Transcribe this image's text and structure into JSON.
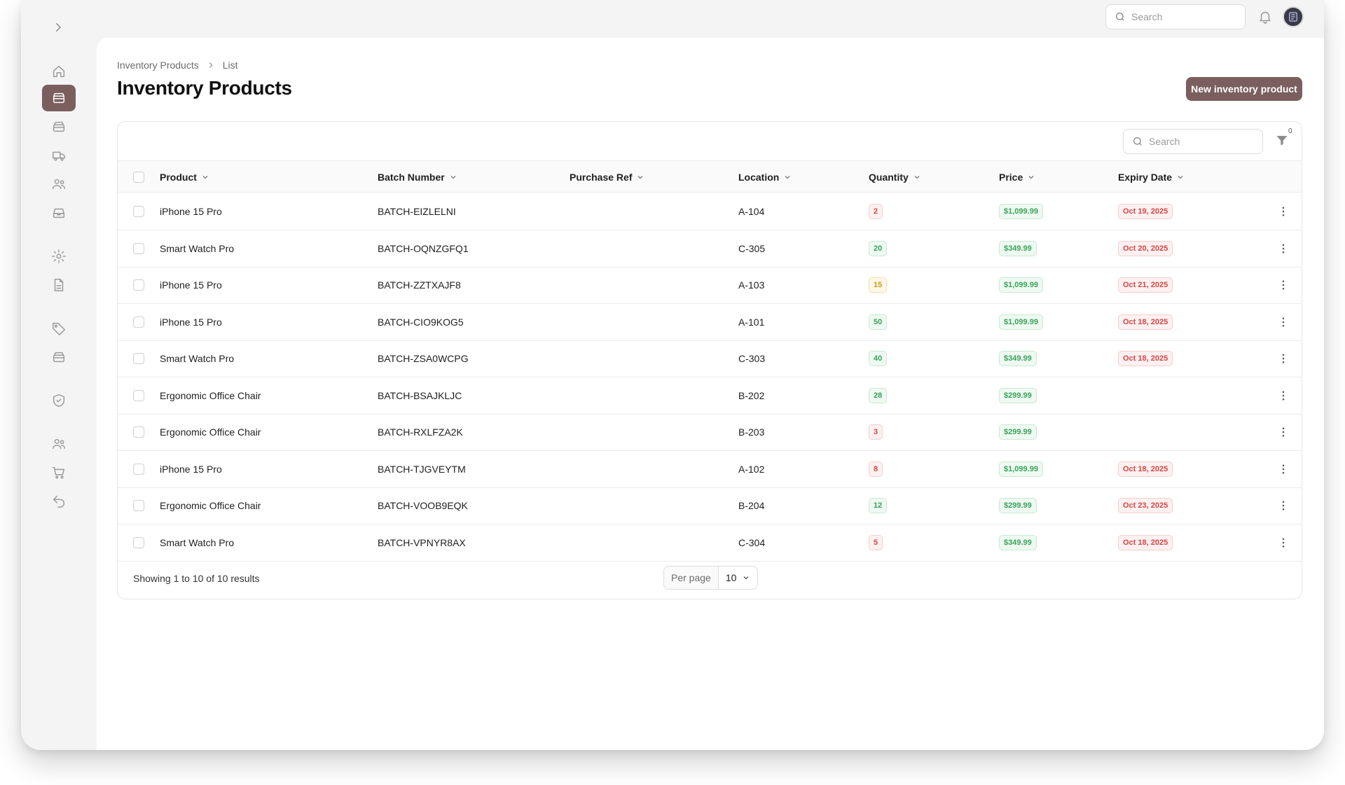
{
  "topbar": {
    "search_placeholder": "Search"
  },
  "sidebar": {
    "items": [
      {
        "icon": "home-icon",
        "active": false
      },
      {
        "icon": "inventory-box-icon",
        "active": true
      },
      {
        "icon": "archive-box-icon",
        "active": false
      },
      {
        "icon": "truck-icon",
        "active": false
      },
      {
        "icon": "users-icon",
        "active": false
      },
      {
        "icon": "inbox-icon",
        "active": false
      },
      {
        "icon": "gear-icon",
        "active": false
      },
      {
        "icon": "document-icon",
        "active": false
      },
      {
        "icon": "tag-icon",
        "active": false
      },
      {
        "icon": "archive-box-icon",
        "active": false
      },
      {
        "icon": "shield-check-icon",
        "active": false
      },
      {
        "icon": "users-icon",
        "active": false
      },
      {
        "icon": "cart-icon",
        "active": false
      },
      {
        "icon": "return-arrow-icon",
        "active": false
      }
    ]
  },
  "breadcrumb": {
    "parent": "Inventory Products",
    "current": "List"
  },
  "page": {
    "title": "Inventory Products",
    "new_button": "New inventory product"
  },
  "table": {
    "search_placeholder": "Search",
    "filter_count": "0",
    "columns": [
      "Product",
      "Batch Number",
      "Purchase Ref",
      "Location",
      "Quantity",
      "Price",
      "Expiry Date"
    ],
    "rows": [
      {
        "product": "iPhone 15 Pro",
        "batch": "BATCH-EIZLELNI",
        "purchase_ref": "",
        "location": "A-104",
        "quantity": "2",
        "qty_status": "red",
        "price": "$1,099.99",
        "expiry": "Oct 19, 2025"
      },
      {
        "product": "Smart Watch Pro",
        "batch": "BATCH-OQNZGFQ1",
        "purchase_ref": "",
        "location": "C-305",
        "quantity": "20",
        "qty_status": "green",
        "price": "$349.99",
        "expiry": "Oct 20, 2025"
      },
      {
        "product": "iPhone 15 Pro",
        "batch": "BATCH-ZZTXAJF8",
        "purchase_ref": "",
        "location": "A-103",
        "quantity": "15",
        "qty_status": "yellow",
        "price": "$1,099.99",
        "expiry": "Oct 21, 2025"
      },
      {
        "product": "iPhone 15 Pro",
        "batch": "BATCH-CIO9KOG5",
        "purchase_ref": "",
        "location": "A-101",
        "quantity": "50",
        "qty_status": "green",
        "price": "$1,099.99",
        "expiry": "Oct 18, 2025"
      },
      {
        "product": "Smart Watch Pro",
        "batch": "BATCH-ZSA0WCPG",
        "purchase_ref": "",
        "location": "C-303",
        "quantity": "40",
        "qty_status": "green",
        "price": "$349.99",
        "expiry": "Oct 18, 2025"
      },
      {
        "product": "Ergonomic Office Chair",
        "batch": "BATCH-BSAJKLJC",
        "purchase_ref": "",
        "location": "B-202",
        "quantity": "28",
        "qty_status": "green",
        "price": "$299.99",
        "expiry": ""
      },
      {
        "product": "Ergonomic Office Chair",
        "batch": "BATCH-RXLFZA2K",
        "purchase_ref": "",
        "location": "B-203",
        "quantity": "3",
        "qty_status": "red",
        "price": "$299.99",
        "expiry": ""
      },
      {
        "product": "iPhone 15 Pro",
        "batch": "BATCH-TJGVEYTM",
        "purchase_ref": "",
        "location": "A-102",
        "quantity": "8",
        "qty_status": "red",
        "price": "$1,099.99",
        "expiry": "Oct 18, 2025"
      },
      {
        "product": "Ergonomic Office Chair",
        "batch": "BATCH-VOOB9EQK",
        "purchase_ref": "",
        "location": "B-204",
        "quantity": "12",
        "qty_status": "green",
        "price": "$299.99",
        "expiry": "Oct 23, 2025"
      },
      {
        "product": "Smart Watch Pro",
        "batch": "BATCH-VPNYR8AX",
        "purchase_ref": "",
        "location": "C-304",
        "quantity": "5",
        "qty_status": "red",
        "price": "$349.99",
        "expiry": "Oct 18, 2025"
      }
    ]
  },
  "pagination": {
    "showing": "Showing 1 to 10 of 10 results",
    "per_page_label": "Per page",
    "per_page_value": "10"
  },
  "colors": {
    "accent": "#7b5e5e",
    "red": "#d64545",
    "green": "#3aa35a",
    "yellow": "#c99a1a"
  }
}
